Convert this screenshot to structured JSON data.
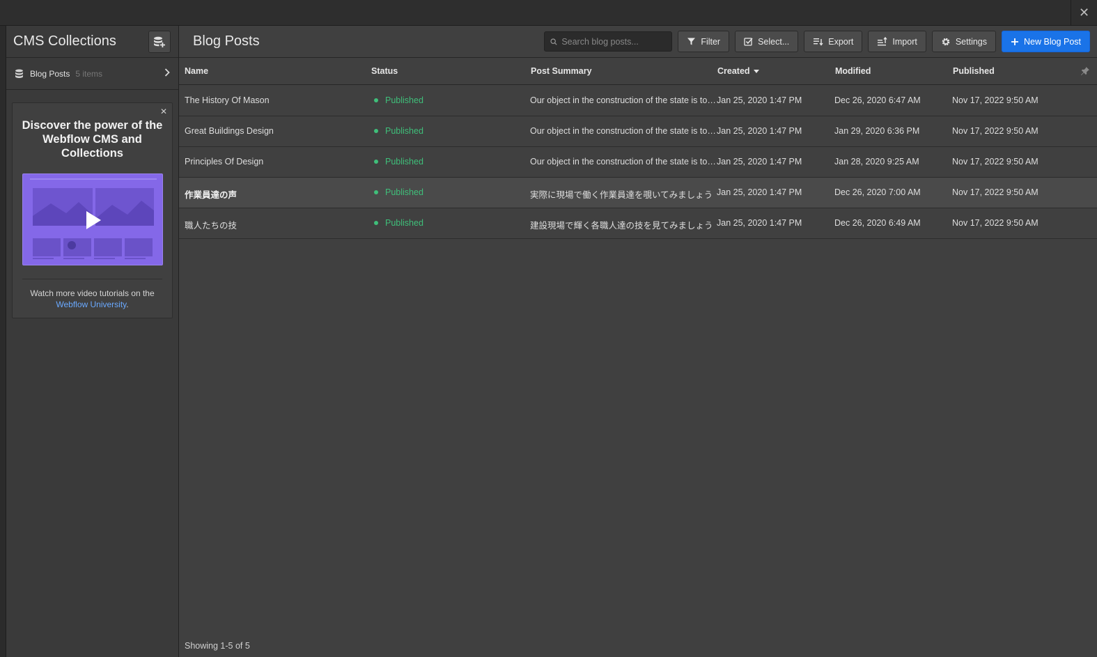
{
  "window": {
    "close_icon": "close-icon"
  },
  "sidebar": {
    "title": "CMS Collections",
    "collections": [
      {
        "name": "Blog Posts",
        "count": "5 items"
      }
    ],
    "promo": {
      "title": "Discover the power of the Webflow CMS and Collections",
      "text_before": "Watch more video tutorials on the",
      "link": "Webflow University",
      "text_after": "."
    }
  },
  "main": {
    "title": "Blog Posts",
    "search_placeholder": "Search blog posts...",
    "toolbar": {
      "filter": "Filter",
      "select": "Select...",
      "export": "Export",
      "import": "Import",
      "settings": "Settings",
      "new": "New Blog Post"
    },
    "columns": {
      "name": "Name",
      "status": "Status",
      "summary": "Post Summary",
      "created": "Created",
      "modified": "Modified",
      "published": "Published"
    },
    "rows": [
      {
        "name": "The History Of Mason",
        "status": "Published",
        "summary": "Our object in the construction of the state is to make the whole state happy",
        "created": "Jan 25, 2020 1:47 PM",
        "modified": "Dec 26, 2020 6:47 AM",
        "published": "Nov 17, 2022 9:50 AM"
      },
      {
        "name": "Great Buildings Design",
        "status": "Published",
        "summary": "Our object in the construction of the state is to make the whole state happy",
        "created": "Jan 25, 2020 1:47 PM",
        "modified": "Jan 29, 2020 6:36 PM",
        "published": "Nov 17, 2022 9:50 AM"
      },
      {
        "name": "Principles Of Design",
        "status": "Published",
        "summary": "Our object in the construction of the state is to make the whole state happy",
        "created": "Jan 25, 2020 1:47 PM",
        "modified": "Jan 28, 2020 9:25 AM",
        "published": "Nov 17, 2022 9:50 AM"
      },
      {
        "name": "作業員達の声",
        "status": "Published",
        "summary": "実際に現場で働く作業員達を覗いてみましょう",
        "created": "Jan 25, 2020 1:47 PM",
        "modified": "Dec 26, 2020 7:00 AM",
        "published": "Nov 17, 2022 9:50 AM"
      },
      {
        "name": "職人たちの技",
        "status": "Published",
        "summary": "建設現場で輝く各職人達の技を見てみましょう",
        "created": "Jan 25, 2020 1:47 PM",
        "modified": "Dec 26, 2020 6:49 AM",
        "published": "Nov 17, 2022 9:50 AM"
      }
    ],
    "footer": "Showing 1-5 of 5"
  },
  "colors": {
    "accent": "#1a73e8",
    "status_published": "#3fbf7a",
    "link": "#6aa9ff",
    "promo_video": "#8468e8"
  }
}
